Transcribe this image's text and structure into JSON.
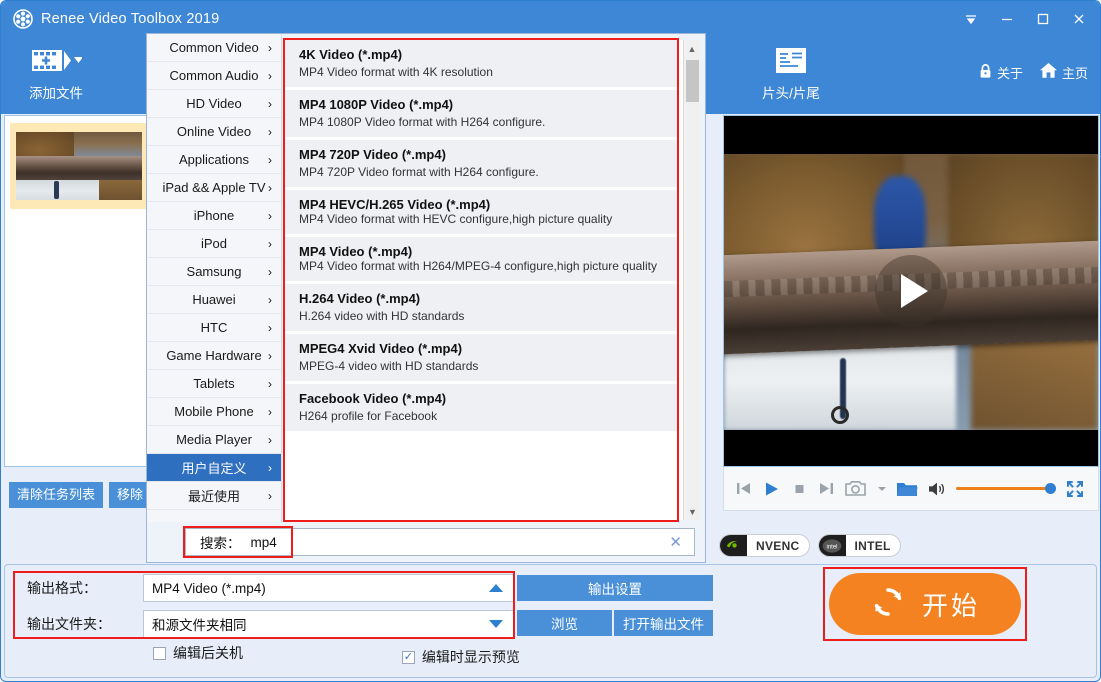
{
  "window": {
    "title": "Renee Video Toolbox 2019",
    "controls": [
      {
        "name": "menu-down",
        "glyph": "▼"
      },
      {
        "name": "minimize",
        "glyph": "—"
      },
      {
        "name": "maximize",
        "glyph": "□"
      },
      {
        "name": "close",
        "glyph": "✕"
      }
    ]
  },
  "toolbar": {
    "add_files_label": "添加文件",
    "intro_outro_label": "片头/片尾",
    "about_label": "关于",
    "home_label": "主页"
  },
  "left_actions": {
    "clear_list": "清除任务列表",
    "remove": "移除"
  },
  "menu": {
    "categories": [
      {
        "label": "Common Video",
        "selected": false
      },
      {
        "label": "Common Audio",
        "selected": false
      },
      {
        "label": "HD Video",
        "selected": false
      },
      {
        "label": "Online Video",
        "selected": false
      },
      {
        "label": "Applications",
        "selected": false
      },
      {
        "label": "iPad && Apple TV",
        "selected": false
      },
      {
        "label": "iPhone",
        "selected": false
      },
      {
        "label": "iPod",
        "selected": false
      },
      {
        "label": "Samsung",
        "selected": false
      },
      {
        "label": "Huawei",
        "selected": false
      },
      {
        "label": "HTC",
        "selected": false
      },
      {
        "label": "Game Hardware",
        "selected": false
      },
      {
        "label": "Tablets",
        "selected": false
      },
      {
        "label": "Mobile Phone",
        "selected": false
      },
      {
        "label": "Media Player",
        "selected": false
      },
      {
        "label": "用户自定义",
        "selected": true
      },
      {
        "label": "最近使用",
        "selected": false
      }
    ],
    "chevron": "›",
    "formats": [
      {
        "title": "4K Video (*.mp4)",
        "desc": "MP4 Video format with 4K resolution"
      },
      {
        "title": "MP4 1080P Video (*.mp4)",
        "desc": "MP4 1080P Video format with H264 configure."
      },
      {
        "title": "MP4 720P Video (*.mp4)",
        "desc": "MP4 720P Video format with H264 configure."
      },
      {
        "title": "MP4 HEVC/H.265 Video (*.mp4)",
        "desc": "MP4 Video format with HEVC configure,high picture quality"
      },
      {
        "title": "MP4 Video (*.mp4)",
        "desc": "MP4 Video format with H264/MPEG-4 configure,high picture quality"
      },
      {
        "title": "H.264 Video (*.mp4)",
        "desc": "H.264 video with HD standards"
      },
      {
        "title": "MPEG4 Xvid Video (*.mp4)",
        "desc": "MPEG-4 video with HD standards"
      },
      {
        "title": "Facebook Video (*.mp4)",
        "desc": "H264 profile for Facebook"
      }
    ],
    "search_label": "搜索：",
    "search_value": "mp4",
    "search_clear": "✕"
  },
  "player": {
    "controls": [
      {
        "name": "previous"
      },
      {
        "name": "play"
      },
      {
        "name": "stop"
      },
      {
        "name": "next"
      },
      {
        "name": "snapshot"
      },
      {
        "name": "snapshot-dropdown"
      },
      {
        "name": "open-folder"
      },
      {
        "name": "volume"
      },
      {
        "name": "fullscreen"
      }
    ],
    "volume_color": "#ef7f1a"
  },
  "codecs": [
    {
      "label": "NVENC",
      "icon": "nvidia-icon"
    },
    {
      "label": "INTEL",
      "icon": "intel-icon"
    }
  ],
  "output": {
    "format_label": "输出格式：",
    "format_value": "MP4 Video (*.mp4)",
    "folder_label": "输出文件夹：",
    "folder_value": "和源文件夹相同",
    "settings_button": "输出设置",
    "browse_button": "浏览",
    "open_output_button": "打开输出文件",
    "shutdown_checkbox": {
      "label": "编辑后关机",
      "checked": false
    },
    "preview_checkbox": {
      "label": "编辑时显示预览",
      "checked": true
    }
  },
  "start_button": {
    "label": "开始",
    "color": "#f58220",
    "icon": "refresh-icon"
  },
  "colors": {
    "brand_blue": "#3d87d6",
    "panel_blue": "#e8eef9",
    "highlight_red": "#ef1c1c",
    "orange": "#f58220"
  }
}
